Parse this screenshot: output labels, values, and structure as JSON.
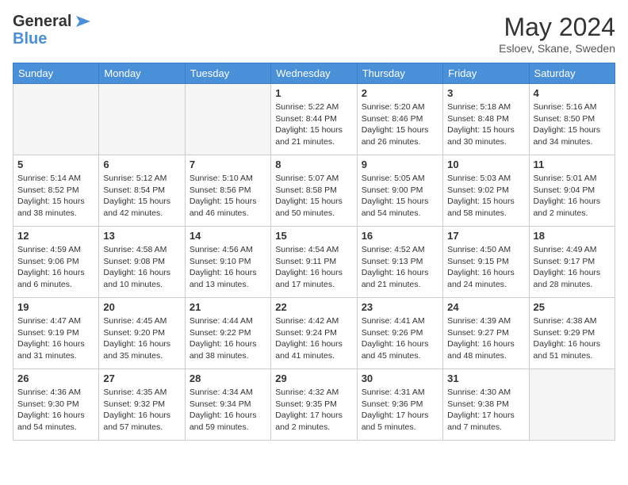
{
  "header": {
    "logo_general": "General",
    "logo_blue": "Blue",
    "month_title": "May 2024",
    "subtitle": "Esloev, Skane, Sweden"
  },
  "weekdays": [
    "Sunday",
    "Monday",
    "Tuesday",
    "Wednesday",
    "Thursday",
    "Friday",
    "Saturday"
  ],
  "weeks": [
    [
      {
        "day": "",
        "info": ""
      },
      {
        "day": "",
        "info": ""
      },
      {
        "day": "",
        "info": ""
      },
      {
        "day": "1",
        "info": "Sunrise: 5:22 AM\nSunset: 8:44 PM\nDaylight: 15 hours\nand 21 minutes."
      },
      {
        "day": "2",
        "info": "Sunrise: 5:20 AM\nSunset: 8:46 PM\nDaylight: 15 hours\nand 26 minutes."
      },
      {
        "day": "3",
        "info": "Sunrise: 5:18 AM\nSunset: 8:48 PM\nDaylight: 15 hours\nand 30 minutes."
      },
      {
        "day": "4",
        "info": "Sunrise: 5:16 AM\nSunset: 8:50 PM\nDaylight: 15 hours\nand 34 minutes."
      }
    ],
    [
      {
        "day": "5",
        "info": "Sunrise: 5:14 AM\nSunset: 8:52 PM\nDaylight: 15 hours\nand 38 minutes."
      },
      {
        "day": "6",
        "info": "Sunrise: 5:12 AM\nSunset: 8:54 PM\nDaylight: 15 hours\nand 42 minutes."
      },
      {
        "day": "7",
        "info": "Sunrise: 5:10 AM\nSunset: 8:56 PM\nDaylight: 15 hours\nand 46 minutes."
      },
      {
        "day": "8",
        "info": "Sunrise: 5:07 AM\nSunset: 8:58 PM\nDaylight: 15 hours\nand 50 minutes."
      },
      {
        "day": "9",
        "info": "Sunrise: 5:05 AM\nSunset: 9:00 PM\nDaylight: 15 hours\nand 54 minutes."
      },
      {
        "day": "10",
        "info": "Sunrise: 5:03 AM\nSunset: 9:02 PM\nDaylight: 15 hours\nand 58 minutes."
      },
      {
        "day": "11",
        "info": "Sunrise: 5:01 AM\nSunset: 9:04 PM\nDaylight: 16 hours\nand 2 minutes."
      }
    ],
    [
      {
        "day": "12",
        "info": "Sunrise: 4:59 AM\nSunset: 9:06 PM\nDaylight: 16 hours\nand 6 minutes."
      },
      {
        "day": "13",
        "info": "Sunrise: 4:58 AM\nSunset: 9:08 PM\nDaylight: 16 hours\nand 10 minutes."
      },
      {
        "day": "14",
        "info": "Sunrise: 4:56 AM\nSunset: 9:10 PM\nDaylight: 16 hours\nand 13 minutes."
      },
      {
        "day": "15",
        "info": "Sunrise: 4:54 AM\nSunset: 9:11 PM\nDaylight: 16 hours\nand 17 minutes."
      },
      {
        "day": "16",
        "info": "Sunrise: 4:52 AM\nSunset: 9:13 PM\nDaylight: 16 hours\nand 21 minutes."
      },
      {
        "day": "17",
        "info": "Sunrise: 4:50 AM\nSunset: 9:15 PM\nDaylight: 16 hours\nand 24 minutes."
      },
      {
        "day": "18",
        "info": "Sunrise: 4:49 AM\nSunset: 9:17 PM\nDaylight: 16 hours\nand 28 minutes."
      }
    ],
    [
      {
        "day": "19",
        "info": "Sunrise: 4:47 AM\nSunset: 9:19 PM\nDaylight: 16 hours\nand 31 minutes."
      },
      {
        "day": "20",
        "info": "Sunrise: 4:45 AM\nSunset: 9:20 PM\nDaylight: 16 hours\nand 35 minutes."
      },
      {
        "day": "21",
        "info": "Sunrise: 4:44 AM\nSunset: 9:22 PM\nDaylight: 16 hours\nand 38 minutes."
      },
      {
        "day": "22",
        "info": "Sunrise: 4:42 AM\nSunset: 9:24 PM\nDaylight: 16 hours\nand 41 minutes."
      },
      {
        "day": "23",
        "info": "Sunrise: 4:41 AM\nSunset: 9:26 PM\nDaylight: 16 hours\nand 45 minutes."
      },
      {
        "day": "24",
        "info": "Sunrise: 4:39 AM\nSunset: 9:27 PM\nDaylight: 16 hours\nand 48 minutes."
      },
      {
        "day": "25",
        "info": "Sunrise: 4:38 AM\nSunset: 9:29 PM\nDaylight: 16 hours\nand 51 minutes."
      }
    ],
    [
      {
        "day": "26",
        "info": "Sunrise: 4:36 AM\nSunset: 9:30 PM\nDaylight: 16 hours\nand 54 minutes."
      },
      {
        "day": "27",
        "info": "Sunrise: 4:35 AM\nSunset: 9:32 PM\nDaylight: 16 hours\nand 57 minutes."
      },
      {
        "day": "28",
        "info": "Sunrise: 4:34 AM\nSunset: 9:34 PM\nDaylight: 16 hours\nand 59 minutes."
      },
      {
        "day": "29",
        "info": "Sunrise: 4:32 AM\nSunset: 9:35 PM\nDaylight: 17 hours\nand 2 minutes."
      },
      {
        "day": "30",
        "info": "Sunrise: 4:31 AM\nSunset: 9:36 PM\nDaylight: 17 hours\nand 5 minutes."
      },
      {
        "day": "31",
        "info": "Sunrise: 4:30 AM\nSunset: 9:38 PM\nDaylight: 17 hours\nand 7 minutes."
      },
      {
        "day": "",
        "info": ""
      }
    ]
  ]
}
